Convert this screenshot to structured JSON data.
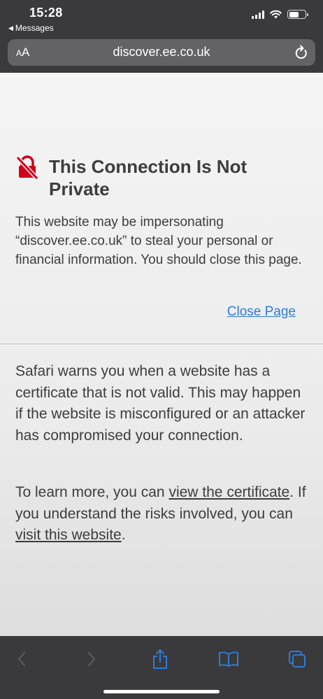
{
  "status_bar": {
    "time": "15:28",
    "back_app": "Messages",
    "back_arrow": "◀"
  },
  "address_bar": {
    "text_size_label": "A",
    "text_size_label_large": "A",
    "url": "discover.ee.co.uk",
    "reload_icon": "reload-icon"
  },
  "warning": {
    "icon": "broken-lock-icon",
    "icon_color": "#d0021b",
    "title": "This Connection Is Not Private",
    "body": "This website may be impersonating “discover.ee.co.uk” to steal your personal or financial information. You should close this page.",
    "close_link": "Close Page",
    "link_color": "#2f7bd6"
  },
  "details": {
    "explanation": "Safari warns you when a website has a certificate that is not valid. This may happen if the website is misconfigured or an attacker has compromised your connection.",
    "learn_prefix": "To learn more, you can ",
    "view_certificate_link": "view the certificate",
    "learn_middle": ". If you understand the risks involved, you can ",
    "visit_website_link": "visit this website",
    "learn_suffix": "."
  },
  "toolbar": {
    "back_icon": "back-chevron-icon",
    "forward_icon": "forward-chevron-icon",
    "share_icon": "share-icon",
    "bookmarks_icon": "bookmarks-icon",
    "tabs_icon": "tabs-icon",
    "accent": "#2f7bd6"
  }
}
